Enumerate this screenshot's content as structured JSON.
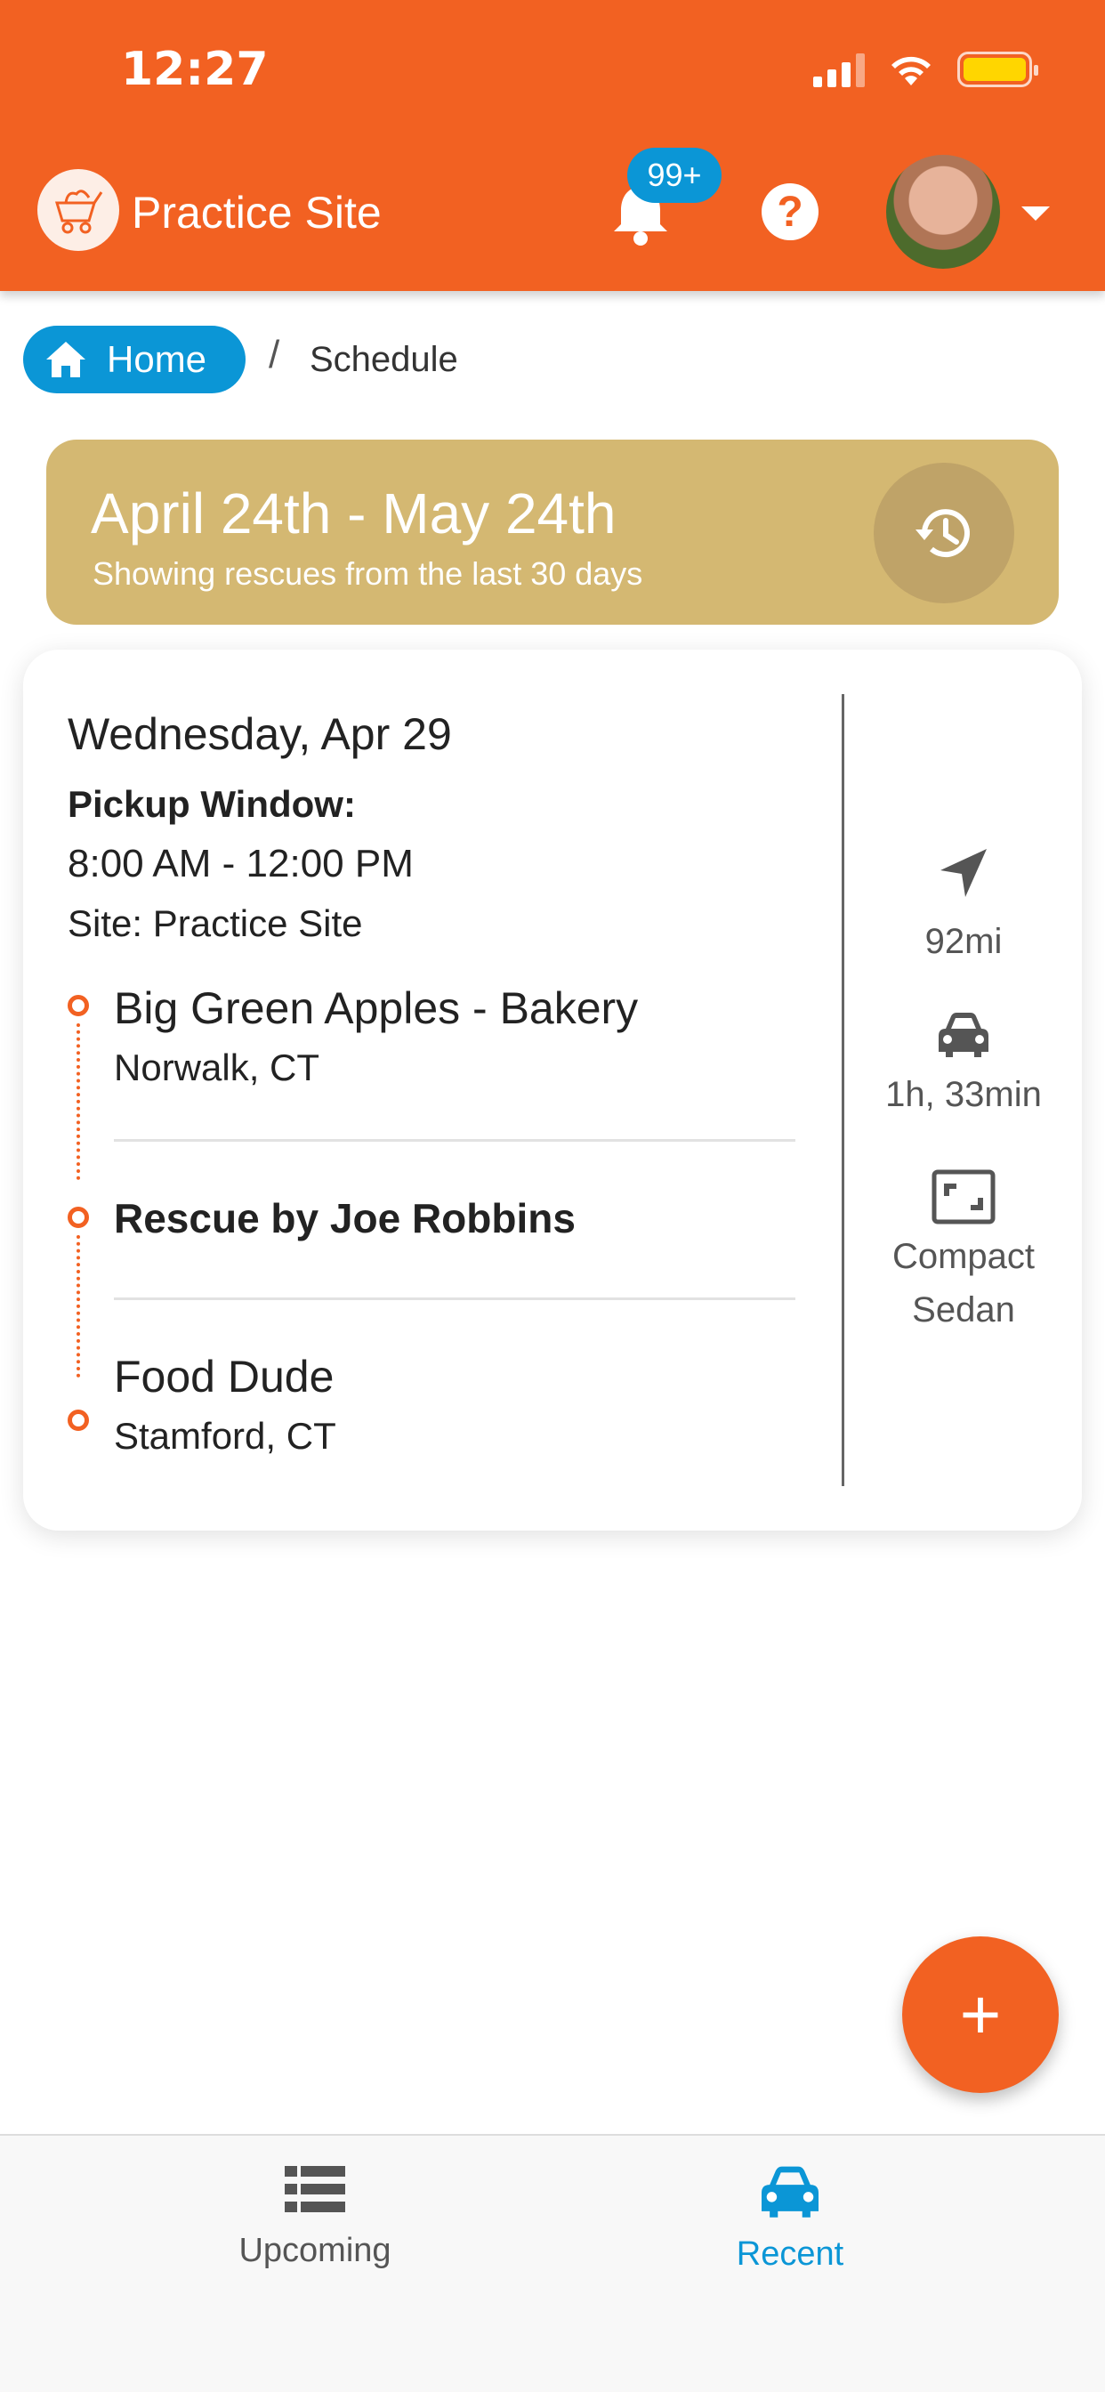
{
  "status_bar": {
    "time": "12:27"
  },
  "header": {
    "site_name": "Practice Site",
    "notification_badge": "99+",
    "help_label": "?"
  },
  "breadcrumb": {
    "home": "Home",
    "separator": "/",
    "current": "Schedule"
  },
  "date_banner": {
    "title": "April 24th - May 24th",
    "subtitle": "Showing rescues from the last 30 days"
  },
  "rescue_card": {
    "date": "Wednesday, Apr 29",
    "pickup_window_label": "Pickup Window:",
    "pickup_window_time": "8:00 AM - 12:00 PM",
    "site": "Site: Practice Site",
    "pickup": {
      "name": "Big Green Apples - Bakery",
      "city": "Norwalk, CT"
    },
    "rescuer": "Rescue by Joe Robbins",
    "dropoff": {
      "name": "Food Dude",
      "city": "Stamford, CT"
    },
    "distance": "92mi",
    "duration": "1h, 33min",
    "vehicle_line1": "Compact",
    "vehicle_line2": "Sedan"
  },
  "fab": {
    "label": "+"
  },
  "bottom_nav": {
    "items": [
      {
        "label": "Upcoming",
        "icon": "list-icon",
        "active": false
      },
      {
        "label": "Recent",
        "icon": "car-icon",
        "active": true
      }
    ],
    "active_color": "#0b96d6",
    "inactive_color": "#555555"
  },
  "colors": {
    "brand": "#f26122",
    "banner": "#d4b872",
    "accent": "#0b96d6"
  }
}
